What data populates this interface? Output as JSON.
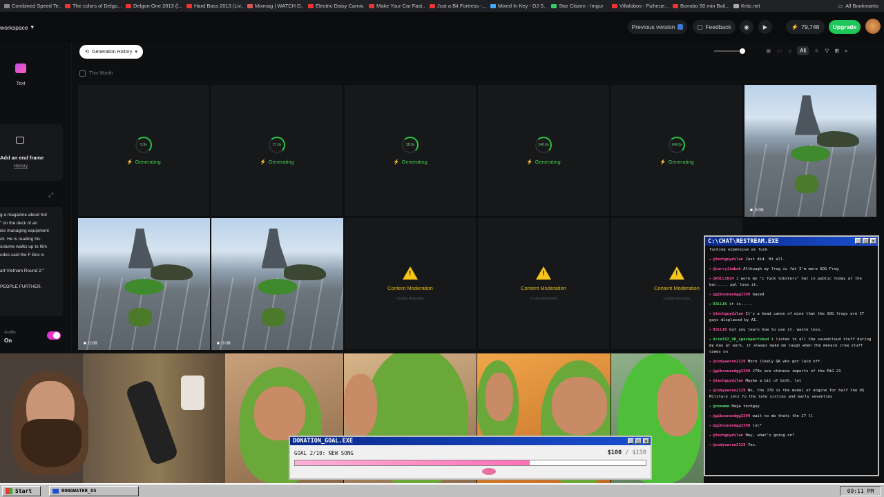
{
  "bookmarks": [
    {
      "label": "Combined Speed Te...",
      "color": "#888"
    },
    {
      "label": "The colors of Delgo...",
      "color": "#e33"
    },
    {
      "label": "Delgon One 2013 (l...",
      "color": "#e33"
    },
    {
      "label": "Hard Bass 2013 (Liv...",
      "color": "#e33"
    },
    {
      "label": "Mixmag | WATCH D...",
      "color": "#d55"
    },
    {
      "label": "Electric Daisy Carniv...",
      "color": "#e33"
    },
    {
      "label": "Make Your Car Fast...",
      "color": "#e33"
    },
    {
      "label": "Just a Bit Fortress -...",
      "color": "#e33"
    },
    {
      "label": "Mixed In Key - DJ S...",
      "color": "#4af"
    },
    {
      "label": "Star Citizen - Imgur",
      "color": "#3c6"
    },
    {
      "label": "Villalobos - Fizheue...",
      "color": "#e33"
    },
    {
      "label": "Bonobo 50 min Boil...",
      "color": "#e33"
    },
    {
      "label": "Kritz.net",
      "color": "#aaa"
    }
  ],
  "all_bookmarks": "All Bookmarks",
  "header": {
    "workspace": "workspace",
    "previous_version": "Previous version",
    "feedback": "Feedback",
    "credits": "79,748",
    "upgrade": "Upgrade"
  },
  "left": {
    "text_label": "Text",
    "end_frame": "Add an end frame",
    "history": "History",
    "prompt_lines": [
      "g a magazine about hot",
      "\" on the deck of an",
      "ies managing equipment",
      "ck. He is reading his",
      "ostume walks up to him",
      "udes said the F Box is",
      "",
      "art Vietnam Round 2.\"",
      "",
      "PEOPLE FURTHER."
    ],
    "audio_label": "Audio",
    "audio_value": "On"
  },
  "toolbar": {
    "history_button": "Generation History",
    "this_month": "This Month",
    "filter_all": "All"
  },
  "generating": [
    {
      "time": "5.9s",
      "label": "Generating"
    },
    {
      "time": "27.0s",
      "label": "Generating"
    },
    {
      "time": "38.0s",
      "label": "Generating"
    },
    {
      "time": "240.0s",
      "label": "Generating"
    },
    {
      "time": "242.0s",
      "label": "Generating"
    }
  ],
  "moderation": {
    "label": "Content Moderation",
    "sub": "Credits Refunded"
  },
  "video_duration": "0:08",
  "chat": {
    "title": "C:\\CHAT\\RESTREAM.EXE",
    "messages": [
      {
        "user": "",
        "text": "fucking expensive as fuck",
        "green": false
      },
      {
        "user": "@techguydilan",
        "text": "Just did. Hi all.",
        "green": false
      },
      {
        "user": "@LarryJimbob",
        "text": "Although my frog is fat I'm more SOG Frog",
        "green": false
      },
      {
        "user": "@R3LLIK24",
        "text": "i wore my \"i fuck lobsters\" hat in public today at the bar..... ppl love it.",
        "green": false
      },
      {
        "user": "@gibsonandgg3390",
        "text": "based",
        "green": false
      },
      {
        "user": "R3LLIK",
        "text": "it is.....",
        "green": true
      },
      {
        "user": "@techguydilan",
        "text": "It's a head canon of mine that the SOG frogs are IT guys displaced by AI.",
        "green": false
      },
      {
        "user": "R3LLIK",
        "text": "but you learn how to use it. waste less.",
        "green": false
      },
      {
        "user": "Ariel92_UR_sparepartsbud",
        "text": "i listen to all the soundcloud stuff during my day at work. it always make me laugh when the menace crew stuff comes on",
        "green": true
      },
      {
        "user": "@codyaaron2129",
        "text": "More likely QA who got laid off.",
        "green": false
      },
      {
        "user": "@gibsonandgg3390",
        "text": "J79s are chinese imports of the MiG 21",
        "green": false
      },
      {
        "user": "@techguydilan",
        "text": "Maybe a bit of both. lol",
        "green": false
      },
      {
        "user": "@codyaaron2129",
        "text": "No, the J79 is the model of engine for half the US Military jets fo the late sixties and early seventies",
        "green": false
      },
      {
        "user": "@noname",
        "text": "Heya techguy",
        "green": true
      },
      {
        "user": "@gibsonandgg3390",
        "text": "wait no mb thats the J7 ll",
        "green": false
      },
      {
        "user": "@gibsonandgg3390",
        "text": "lol*",
        "green": false
      },
      {
        "user": "@techguydilan",
        "text": "Hey, what's going on?",
        "green": false
      },
      {
        "user": "@codyaaron2129",
        "text": "Yes.",
        "green": false
      }
    ]
  },
  "donation": {
    "title": "DONATION_GOAL.EXE",
    "goal": "GOAL 2/10: NEW SONG",
    "amount": "$100",
    "target": "/ $150",
    "progress": 0.67
  },
  "taskbar": {
    "start": "Start",
    "task": "BONGWATER_OS",
    "clock": "09:11 PM"
  }
}
